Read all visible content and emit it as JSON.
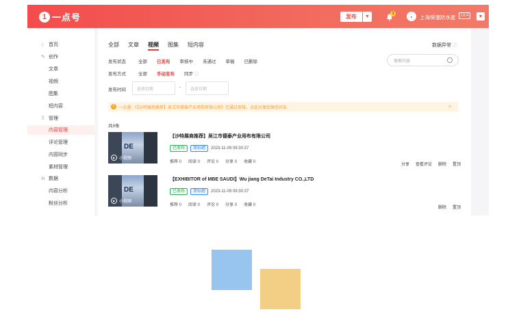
{
  "header": {
    "logo_mark": "1",
    "logo_text": "一点号",
    "publish_label": "发布",
    "notification_count": "3",
    "username": "上海保温防水星",
    "level": "LV.4",
    "brand_color": "#f34c4c"
  },
  "sidebar": {
    "items": [
      {
        "label": "首页",
        "icon": "home-icon"
      },
      {
        "label": "创作",
        "icon": "pen-icon"
      },
      {
        "label": "文章"
      },
      {
        "label": "视频"
      },
      {
        "label": "图集"
      },
      {
        "label": "短内容"
      },
      {
        "label": "管理",
        "icon": "grid-icon"
      },
      {
        "label": "内容管理"
      },
      {
        "label": "评论管理"
      },
      {
        "label": "内容同步"
      },
      {
        "label": "素材管理"
      },
      {
        "label": "数据",
        "icon": "chart-icon"
      },
      {
        "label": "内容分析"
      },
      {
        "label": "粉丝分析"
      }
    ]
  },
  "main": {
    "tabs": [
      "全部",
      "文章",
      "视频",
      "图集",
      "短内容"
    ],
    "data_anomaly": "数据异常",
    "status_label": "发布状态",
    "status_options": [
      "全部",
      "已发布",
      "审核中",
      "未通过",
      "草稿",
      "已删除"
    ],
    "method_label": "发布方式",
    "method_options": [
      "全部",
      "手动发布",
      "同步"
    ],
    "time_label": "发布时间",
    "start_date_placeholder": "选择日期",
    "end_date_placeholder": "选择日期",
    "date_separator": "-",
    "search_placeholder": "搜索内容",
    "notice": "一点通：《【沙特展商推荐】吴江市德泰产业用布有限公司》已通过审核，点此分享给微信好友",
    "total": "共9条"
  },
  "items": [
    {
      "title": "【沙特展商推荐】吴江市德泰产业用布有限公司",
      "status": "已发布",
      "tag": "双标题",
      "time": "2023-11-09 09:30:37",
      "thumb_label": "小视频",
      "stats": [
        "推荐 0",
        "阅读 0",
        "评论 0",
        "分享 0",
        "收藏 0"
      ],
      "actions": [
        "分享",
        "查看评论",
        "删除",
        "置顶"
      ]
    },
    {
      "title": "【EXHIBITOR of MBE SAUDI】Wu jiang DeTai Industry CO.,LTD",
      "status": "已发布",
      "tag": "双标题",
      "time": "2023-11-09 09:30:37",
      "thumb_label": "小视频",
      "stats": [
        "推荐 0",
        "阅读 0",
        "评论 0",
        "分享 0",
        "收藏 0"
      ],
      "actions": [
        "删除",
        "置顶"
      ]
    }
  ]
}
